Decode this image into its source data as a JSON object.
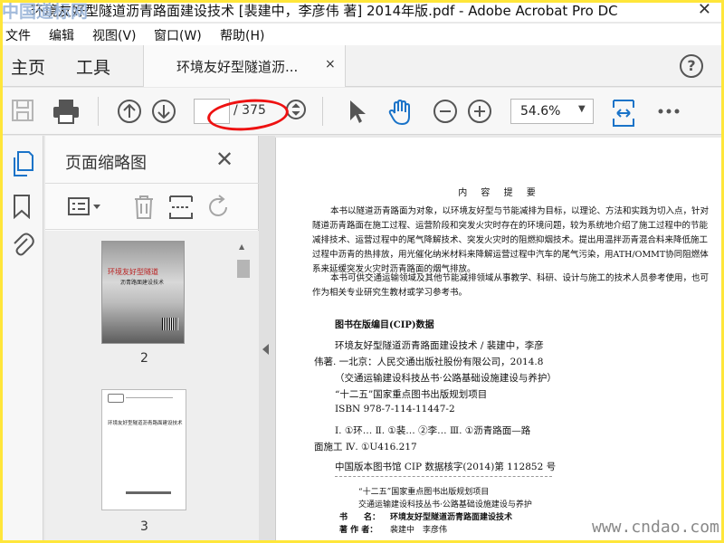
{
  "window": {
    "title": "环境友好型隧道沥青路面建设技术 [裴建中，李彦伟 著] 2014年版.pdf - Adobe Acrobat Pro DC",
    "watermark_top": "中国道标网"
  },
  "menu": [
    "文件",
    "编辑",
    "视图(V)",
    "窗口(W)",
    "帮助(H)"
  ],
  "tabs": {
    "home": "主页",
    "tools": "工具",
    "document": "环境友好型隧道沥...",
    "close": "×"
  },
  "toolbar": {
    "page_current": "",
    "page_total": "/ 375",
    "zoom": "54.6%"
  },
  "panel": {
    "title": "页面缩略图",
    "thumbnails": [
      {
        "label": "2",
        "cover_title": "环境友好型隧道",
        "cover_subtitle": "沥青路面建设技术"
      },
      {
        "label": "3",
        "heading": "环境友好型隧道沥青路面建设技术"
      }
    ]
  },
  "document": {
    "heading": "内 容 提 要",
    "summary_p1": "本书以隧道沥青路面为对象，以环境友好型与节能减排为目标，以理论、方法和实践为切入点，针对隧道沥青路面在施工过程、运营阶段和突发火灾时存在的环境问题，较为系统地介绍了施工过程中的节能减排技术、运营过程中的尾气降解技术、突发火灾时的阻燃抑烟技术。提出用温拌沥青混合料来降低施工过程中沥青的热排放，用光催化纳米材料来降解运营过程中汽车的尾气污染，用ATH/OMMT协同阻燃体系来延缓突发火灾时沥青路面的烟气排放。",
    "summary_p2": "本书可供交通运输领域及其他节能减排领域从事教学、科研、设计与施工的技术人员参考使用，也可作为相关专业研究生教材或学习参考书。",
    "cip_title": "图书在版编目(CIP)数据",
    "cip_lines": [
      "环境友好型隧道沥青路面建设技术 / 裴建中，李彦",
      "伟著. 一北京：人民交通出版社股份有限公司，2014.8",
      "（交通运输建设科技丛书·公路基础设施建设与养护）",
      "“十二五”国家重点图书出版规划项目",
      "ISBN 978-7-114-11447-2",
      "Ⅰ. ①环…  Ⅱ. ①裴…  ②李…  Ⅲ. ①沥青路面—路",
      "面施工  Ⅳ. ①U416.217",
      "中国版本图书馆 CIP 数据核字(2014)第 112852 号"
    ],
    "footer_lines": [
      "“十二五”国家重点图书出版规划项目",
      "交通运输建设科技丛书·公路基础设施建设与养护"
    ],
    "book_label": "书　　名：",
    "book_name": "环境友好型隧道沥青路面建设技术",
    "author_label": "著 作 者：",
    "author_name": "裴建中　李彦伟"
  },
  "watermark_bottom": "www.cndao.com"
}
